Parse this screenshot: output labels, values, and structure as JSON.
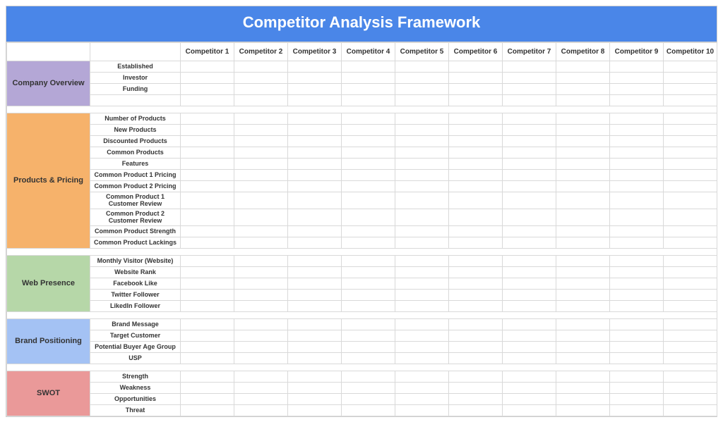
{
  "title": "Competitor Analysis Framework",
  "columns": [
    "Competitor 1",
    "Competitor 2",
    "Competitor 3",
    "Competitor 4",
    "Competitor 5",
    "Competitor 6",
    "Competitor 7",
    "Competitor 8",
    "Competitor 9",
    "Competitor 10"
  ],
  "value_cells": [
    "",
    "",
    "",
    "",
    "",
    "",
    "",
    "",
    "",
    ""
  ],
  "sections": [
    {
      "name": "Company Overview",
      "color": "#b4a7d6",
      "rows": [
        "Established",
        "Investor",
        "Funding",
        ""
      ]
    },
    {
      "name": "Products & Pricing",
      "color": "#f6b26b",
      "rows": [
        "Number of Products",
        "New Products",
        "Discounted Products",
        "Common Products",
        "Features",
        "Common Product  1 Pricing",
        "Common Product  2 Pricing",
        "Common Product 1 Customer Review",
        "Common Product 2 Customer Review",
        "Common Product Strength",
        "Common Product Lackings"
      ]
    },
    {
      "name": "Web Presence",
      "color": "#b6d7a8",
      "rows": [
        "Monthly Visitor (Website)",
        "Website Rank",
        "Facebook Like",
        "Twitter Follower",
        "LikedIn Follower"
      ]
    },
    {
      "name": "Brand Positioning",
      "color": "#a4c2f4",
      "rows": [
        "Brand Message",
        "Target Customer",
        "Potential Buyer Age Group",
        "USP"
      ]
    },
    {
      "name": "SWOT",
      "color": "#ea9999",
      "rows": [
        "Strength",
        "Weakness",
        "Opportunities",
        "Threat"
      ]
    }
  ]
}
